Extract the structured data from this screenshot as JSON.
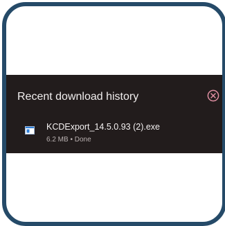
{
  "downloads_panel": {
    "title": "Recent download history",
    "close_icon": "close-circle-icon",
    "items": [
      {
        "file_name": "KCDExport_14.5.0.93 (2).exe",
        "size": "6.2 MB",
        "separator": "•",
        "status": "Done",
        "icon": "executable-file-icon"
      }
    ]
  },
  "colors": {
    "frame_border": "#254a68",
    "panel_background": "#221c1c",
    "close_icon": "#e08fa2",
    "file_icon_blue": "#2f7fd8"
  }
}
